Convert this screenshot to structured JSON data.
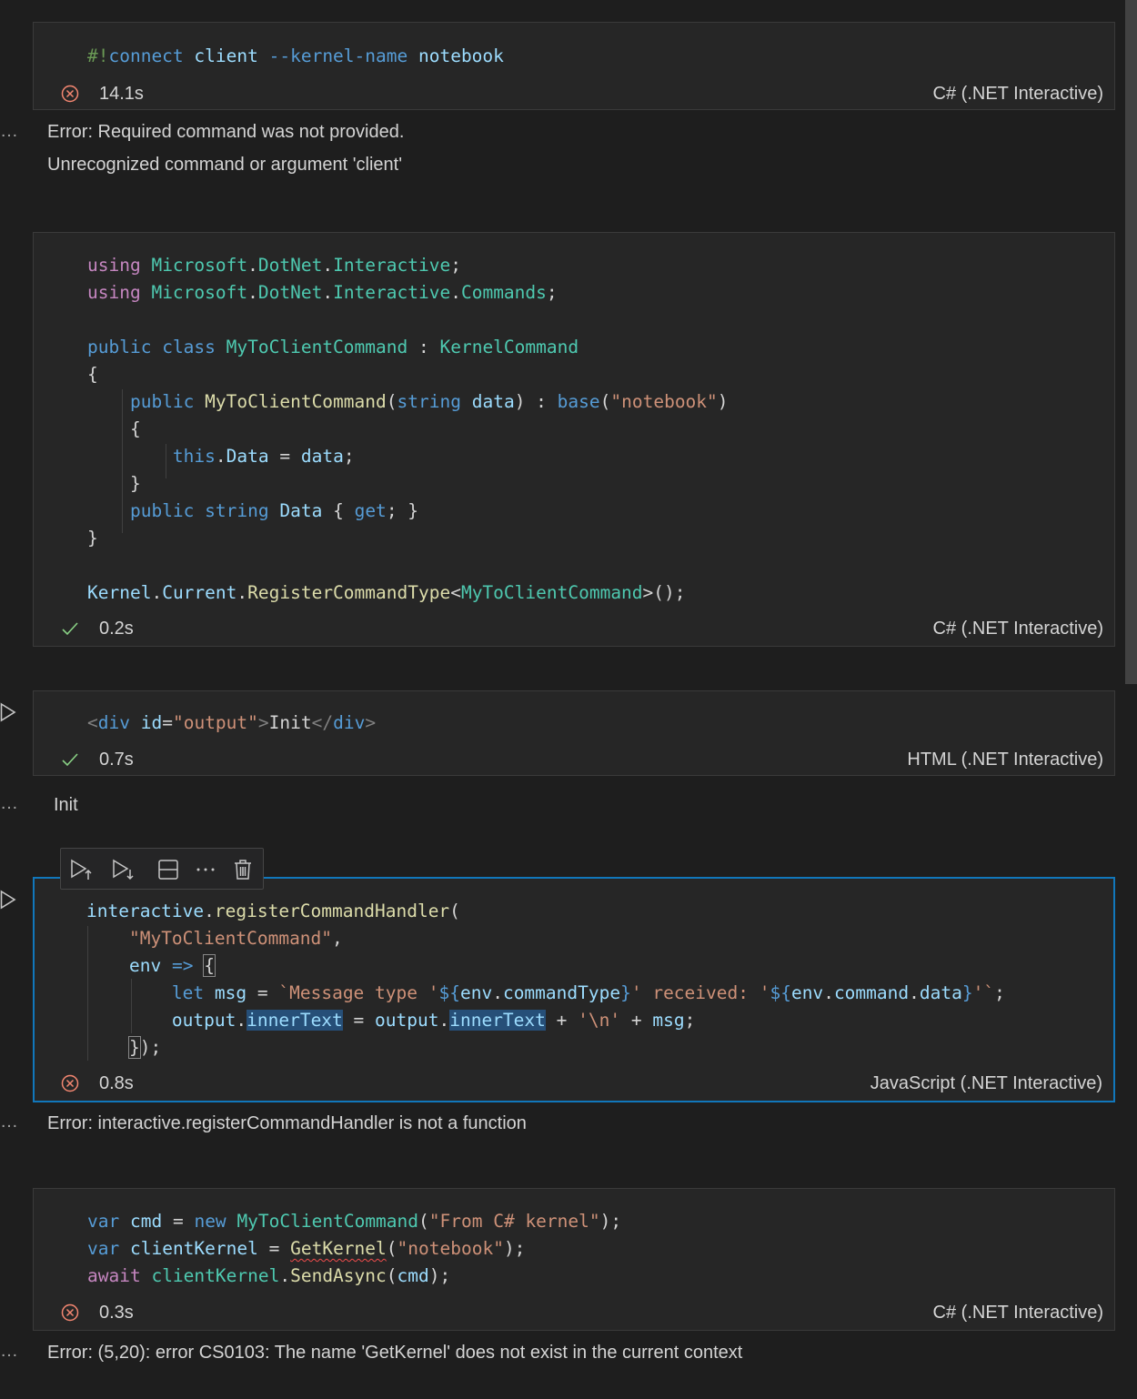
{
  "cells": [
    {
      "status": "error",
      "time": "14.1s",
      "language": "C# (.NET Interactive)",
      "code": [
        [
          [
            "#!",
            "cm"
          ],
          [
            "connect",
            "kb"
          ],
          [
            " ",
            "pu"
          ],
          [
            "client",
            "vr"
          ],
          [
            " --kernel-name ",
            "kb"
          ],
          [
            "notebook",
            "vr"
          ]
        ]
      ],
      "output": [
        "Error: Required command was not provided.",
        "Unrecognized command or argument 'client'"
      ]
    },
    {
      "status": "success",
      "time": "0.2s",
      "language": "C# (.NET Interactive)",
      "code": [
        [
          [
            "using",
            "kw"
          ],
          [
            " ",
            "pu"
          ],
          [
            "Microsoft",
            "ty"
          ],
          [
            ".",
            "pu"
          ],
          [
            "DotNet",
            "ty"
          ],
          [
            ".",
            "pu"
          ],
          [
            "Interactive",
            "ty"
          ],
          [
            ";",
            "pu"
          ]
        ],
        [
          [
            "using",
            "kw"
          ],
          [
            " ",
            "pu"
          ],
          [
            "Microsoft",
            "ty"
          ],
          [
            ".",
            "pu"
          ],
          [
            "DotNet",
            "ty"
          ],
          [
            ".",
            "pu"
          ],
          [
            "Interactive",
            "ty"
          ],
          [
            ".",
            "pu"
          ],
          [
            "Commands",
            "ty"
          ],
          [
            ";",
            "pu"
          ]
        ],
        [],
        [
          [
            "public",
            "kb"
          ],
          [
            " ",
            "pu"
          ],
          [
            "class",
            "kb"
          ],
          [
            " ",
            "pu"
          ],
          [
            "MyToClientCommand",
            "ty"
          ],
          [
            " : ",
            "pu"
          ],
          [
            "KernelCommand",
            "ty"
          ]
        ],
        [
          [
            "{",
            "pu"
          ]
        ],
        [
          [
            "    ",
            "pu"
          ],
          [
            "public",
            "kb"
          ],
          [
            " ",
            "pu"
          ],
          [
            "MyToClientCommand",
            "fn"
          ],
          [
            "(",
            "pu"
          ],
          [
            "string",
            "kb"
          ],
          [
            " ",
            "pu"
          ],
          [
            "data",
            "vr"
          ],
          [
            ") : ",
            "pu"
          ],
          [
            "base",
            "kb"
          ],
          [
            "(",
            "pu"
          ],
          [
            "\"notebook\"",
            "st"
          ],
          [
            ")",
            "pu"
          ]
        ],
        [
          [
            "    {",
            "pu"
          ]
        ],
        [
          [
            "        ",
            "pu"
          ],
          [
            "this",
            "kb"
          ],
          [
            ".",
            "pu"
          ],
          [
            "Data",
            "vr"
          ],
          [
            " = ",
            "pu"
          ],
          [
            "data",
            "vr"
          ],
          [
            ";",
            "pu"
          ]
        ],
        [
          [
            "    }",
            "pu"
          ]
        ],
        [
          [
            "    ",
            "pu"
          ],
          [
            "public",
            "kb"
          ],
          [
            " ",
            "pu"
          ],
          [
            "string",
            "kb"
          ],
          [
            " ",
            "pu"
          ],
          [
            "Data",
            "vr"
          ],
          [
            " { ",
            "pu"
          ],
          [
            "get",
            "kb"
          ],
          [
            "; }",
            "pu"
          ]
        ],
        [
          [
            "}",
            "pu"
          ]
        ],
        [],
        [
          [
            "Kernel",
            "vr"
          ],
          [
            ".",
            "pu"
          ],
          [
            "Current",
            "vr"
          ],
          [
            ".",
            "pu"
          ],
          [
            "RegisterCommandType",
            "fn"
          ],
          [
            "<",
            "pu"
          ],
          [
            "MyToClientCommand",
            "ty"
          ],
          [
            ">();",
            "pu"
          ]
        ]
      ],
      "output": []
    },
    {
      "status": "success",
      "time": "0.7s",
      "language": "HTML (.NET Interactive)",
      "code": [
        [
          [
            "<",
            "tg"
          ],
          [
            "div",
            "kb"
          ],
          [
            " ",
            "pu"
          ],
          [
            "id",
            "vr"
          ],
          [
            "=",
            "pu"
          ],
          [
            "\"output\"",
            "st"
          ],
          [
            ">",
            "tg"
          ],
          [
            "Init",
            "pu"
          ],
          [
            "</",
            "tg"
          ],
          [
            "div",
            "kb"
          ],
          [
            ">",
            "tg"
          ]
        ]
      ],
      "output": [
        "Init"
      ]
    },
    {
      "status": "error",
      "time": "0.8s",
      "language": "JavaScript (.NET Interactive)",
      "code": [
        [
          [
            "interactive",
            "vr"
          ],
          [
            ".",
            "pu"
          ],
          [
            "registerCommandHandler",
            "fn"
          ],
          [
            "(",
            "pu"
          ]
        ],
        [
          [
            "    ",
            "pu"
          ],
          [
            "\"MyToClientCommand\"",
            "st"
          ],
          [
            ",",
            "pu"
          ]
        ],
        [
          [
            "    ",
            "pu"
          ],
          [
            "env",
            "vr"
          ],
          [
            " ",
            "pu"
          ],
          [
            "=>",
            "kb"
          ],
          [
            " ",
            "pu"
          ],
          [
            "{",
            "pu br"
          ]
        ],
        [
          [
            "        ",
            "pu"
          ],
          [
            "let",
            "kb"
          ],
          [
            " ",
            "pu"
          ],
          [
            "msg",
            "vr"
          ],
          [
            " = ",
            "pu"
          ],
          [
            "`Message type '",
            "st"
          ],
          [
            "${",
            "kb"
          ],
          [
            "env",
            "vr"
          ],
          [
            ".",
            "pu"
          ],
          [
            "commandType",
            "vr"
          ],
          [
            "}",
            "kb"
          ],
          [
            "' received: '",
            "st"
          ],
          [
            "${",
            "kb"
          ],
          [
            "env",
            "vr"
          ],
          [
            ".",
            "pu"
          ],
          [
            "command",
            "vr"
          ],
          [
            ".",
            "pu"
          ],
          [
            "data",
            "vr"
          ],
          [
            "}",
            "kb"
          ],
          [
            "'`",
            "st"
          ],
          [
            ";",
            "pu"
          ]
        ],
        [
          [
            "        ",
            "pu"
          ],
          [
            "output",
            "vr"
          ],
          [
            ".",
            "pu"
          ],
          [
            "innerText",
            "vr hl"
          ],
          [
            " = ",
            "pu"
          ],
          [
            "output",
            "vr"
          ],
          [
            ".",
            "pu"
          ],
          [
            "innerText",
            "vr hl"
          ],
          [
            " + ",
            "pu"
          ],
          [
            "'\\n'",
            "st"
          ],
          [
            " + ",
            "pu"
          ],
          [
            "msg",
            "vr"
          ],
          [
            ";",
            "pu"
          ]
        ],
        [
          [
            "    ",
            "pu"
          ],
          [
            "}",
            "pu br"
          ],
          [
            ");",
            "pu"
          ]
        ]
      ],
      "output": [
        "Error: interactive.registerCommandHandler is not a function"
      ]
    },
    {
      "status": "error",
      "time": "0.3s",
      "language": "C# (.NET Interactive)",
      "code": [
        [
          [
            "var",
            "kb"
          ],
          [
            " ",
            "pu"
          ],
          [
            "cmd",
            "vr"
          ],
          [
            " = ",
            "pu"
          ],
          [
            "new",
            "kb"
          ],
          [
            " ",
            "pu"
          ],
          [
            "MyToClientCommand",
            "ty"
          ],
          [
            "(",
            "pu"
          ],
          [
            "\"From C# kernel\"",
            "st"
          ],
          [
            ");",
            "pu"
          ]
        ],
        [
          [
            "var",
            "kb"
          ],
          [
            " ",
            "pu"
          ],
          [
            "clientKernel",
            "vr"
          ],
          [
            " = ",
            "pu"
          ],
          [
            "GetKernel",
            "fn squig"
          ],
          [
            "(",
            "pu"
          ],
          [
            "\"notebook\"",
            "st"
          ],
          [
            ");",
            "pu"
          ]
        ],
        [
          [
            "await",
            "kw"
          ],
          [
            " ",
            "pu"
          ],
          [
            "clientKernel",
            "ty"
          ],
          [
            ".",
            "pu"
          ],
          [
            "SendAsync",
            "fn"
          ],
          [
            "(",
            "pu"
          ],
          [
            "cmd",
            "vr"
          ],
          [
            ");",
            "pu"
          ]
        ]
      ],
      "output": [
        "Error: (5,20): error CS0103: The name 'GetKernel' does not exist in the current context"
      ]
    }
  ],
  "toolbar": {
    "buttons": [
      "execute-above-icon",
      "execute-below-icon",
      "split-cell-icon",
      "more-actions-icon",
      "delete-cell-icon"
    ]
  },
  "colors": {
    "error": "#f48771",
    "success": "#89d185",
    "focus_border": "#1177bb"
  }
}
